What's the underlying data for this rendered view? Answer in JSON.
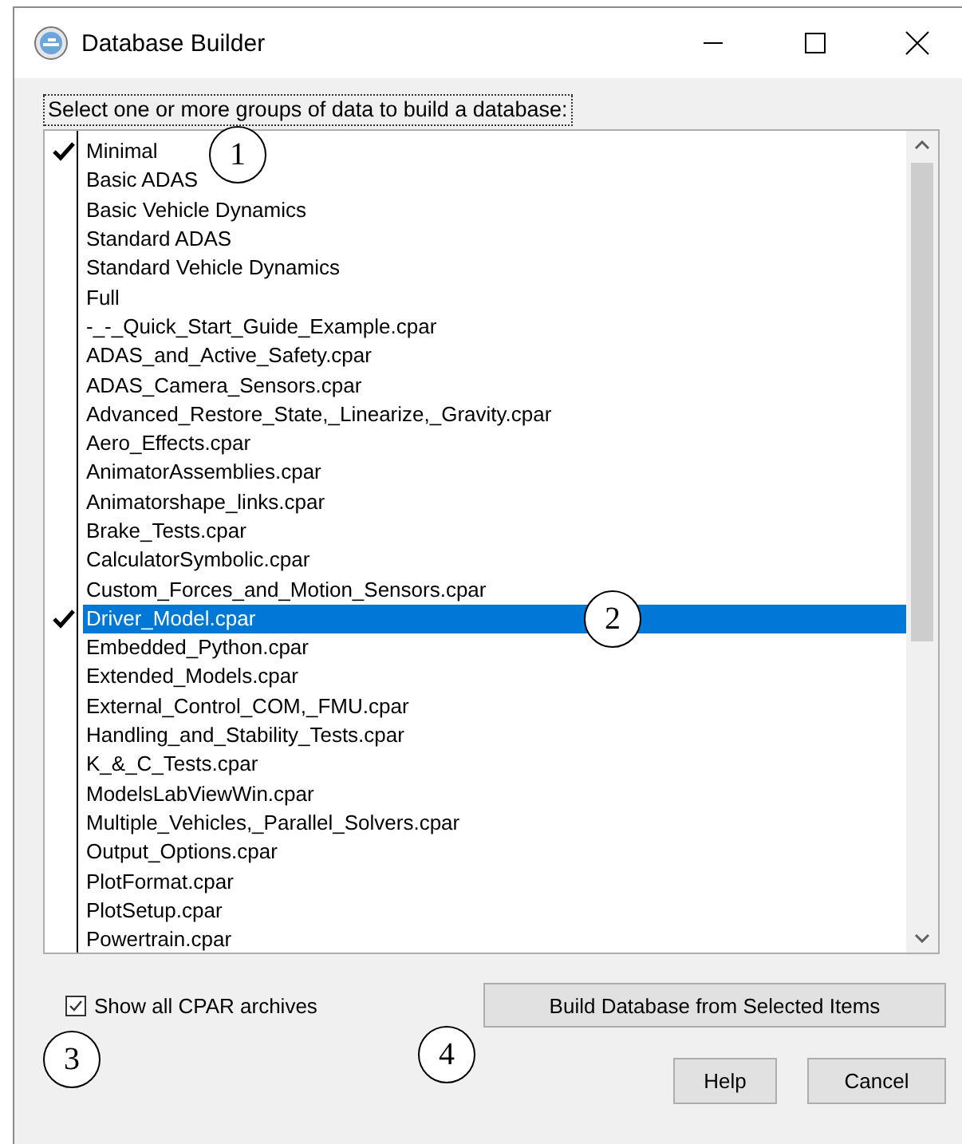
{
  "window": {
    "title": "Database Builder"
  },
  "prompt": "Select one or more groups of data to build a database:",
  "items": [
    {
      "label": "Minimal",
      "checked": true,
      "selected": false
    },
    {
      "label": "Basic ADAS",
      "checked": false,
      "selected": false
    },
    {
      "label": "Basic Vehicle Dynamics",
      "checked": false,
      "selected": false
    },
    {
      "label": "Standard ADAS",
      "checked": false,
      "selected": false
    },
    {
      "label": "Standard Vehicle Dynamics",
      "checked": false,
      "selected": false
    },
    {
      "label": "Full",
      "checked": false,
      "selected": false
    },
    {
      "label": "-_-_Quick_Start_Guide_Example.cpar",
      "checked": false,
      "selected": false
    },
    {
      "label": "ADAS_and_Active_Safety.cpar",
      "checked": false,
      "selected": false
    },
    {
      "label": "ADAS_Camera_Sensors.cpar",
      "checked": false,
      "selected": false
    },
    {
      "label": "Advanced_Restore_State,_Linearize,_Gravity.cpar",
      "checked": false,
      "selected": false
    },
    {
      "label": "Aero_Effects.cpar",
      "checked": false,
      "selected": false
    },
    {
      "label": "AnimatorAssemblies.cpar",
      "checked": false,
      "selected": false
    },
    {
      "label": "Animatorshape_links.cpar",
      "checked": false,
      "selected": false
    },
    {
      "label": "Brake_Tests.cpar",
      "checked": false,
      "selected": false
    },
    {
      "label": "CalculatorSymbolic.cpar",
      "checked": false,
      "selected": false
    },
    {
      "label": "Custom_Forces_and_Motion_Sensors.cpar",
      "checked": false,
      "selected": false
    },
    {
      "label": "Driver_Model.cpar",
      "checked": true,
      "selected": true
    },
    {
      "label": "Embedded_Python.cpar",
      "checked": false,
      "selected": false
    },
    {
      "label": "Extended_Models.cpar",
      "checked": false,
      "selected": false
    },
    {
      "label": "External_Control_COM,_FMU.cpar",
      "checked": false,
      "selected": false
    },
    {
      "label": "Handling_and_Stability_Tests.cpar",
      "checked": false,
      "selected": false
    },
    {
      "label": "K_&_C_Tests.cpar",
      "checked": false,
      "selected": false
    },
    {
      "label": "ModelsLabViewWin.cpar",
      "checked": false,
      "selected": false
    },
    {
      "label": "Multiple_Vehicles,_Parallel_Solvers.cpar",
      "checked": false,
      "selected": false
    },
    {
      "label": "Output_Options.cpar",
      "checked": false,
      "selected": false
    },
    {
      "label": "PlotFormat.cpar",
      "checked": false,
      "selected": false
    },
    {
      "label": "PlotSetup.cpar",
      "checked": false,
      "selected": false
    },
    {
      "label": "Powertrain.cpar",
      "checked": false,
      "selected": false
    }
  ],
  "show_all": {
    "label": "Show all CPAR archives",
    "checked": true
  },
  "build_button": "Build Database from Selected Items",
  "buttons": [
    "Help",
    "Cancel"
  ],
  "callouts": [
    {
      "text": "1"
    },
    {
      "text": "2"
    },
    {
      "text": "3"
    },
    {
      "text": "4"
    }
  ]
}
